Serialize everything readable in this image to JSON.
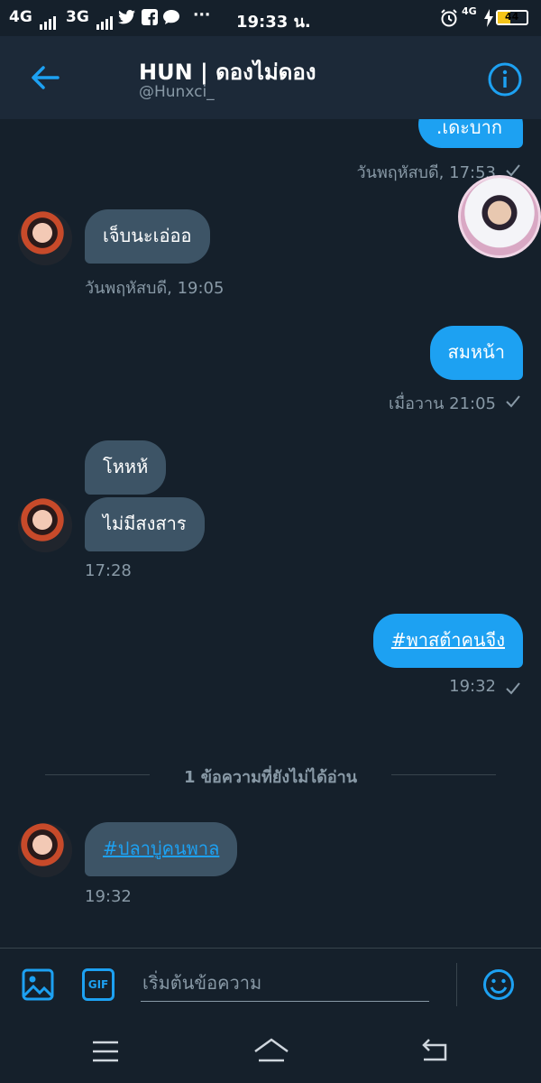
{
  "status_bar": {
    "net1": "4G",
    "net2": "3G",
    "time": "19:33 น.",
    "net3": "4G",
    "battery": "44",
    "dots": "···"
  },
  "header": {
    "title": "HUN | ดองไม่ดอง",
    "handle": "@Hunxci_"
  },
  "messages": [
    {
      "dir": "out",
      "text": ".เดะบาก",
      "meta": "วันพฤหัสบดี, 17:53"
    },
    {
      "dir": "in",
      "text": "เจ็บนะเอ่ออ",
      "meta": "วันพฤหัสบดี, 19:05"
    },
    {
      "dir": "out",
      "text": "สมหน้า",
      "meta": "เมื่อวาน 21:05"
    },
    {
      "dir": "in",
      "text": "โหหห้",
      "meta": ""
    },
    {
      "dir": "in",
      "text": "ไม่มีสงสาร",
      "meta": "17:28"
    },
    {
      "dir": "out",
      "text": "#พาสต้าคนจีง",
      "meta": "19:32"
    },
    {
      "dir": "in",
      "text": "#ปลาบู่คนพาล",
      "meta": "19:32"
    }
  ],
  "unread_label": "1 ข้อความที่ยังไม่ได้อ่าน",
  "composer": {
    "placeholder": "เริ่มต้นข้อความ",
    "gif_label": "GIF"
  },
  "colors": {
    "background": "#15202b",
    "header": "#1c2938",
    "accent": "#1da1f2",
    "incoming_bubble": "#3d5466",
    "muted_text": "#8899a6"
  },
  "icons": [
    "back-arrow-icon",
    "info-icon",
    "image-icon",
    "gif-icon",
    "emoji-icon",
    "menu-icon",
    "home-icon",
    "back-nav-icon",
    "checkmark-icon"
  ]
}
